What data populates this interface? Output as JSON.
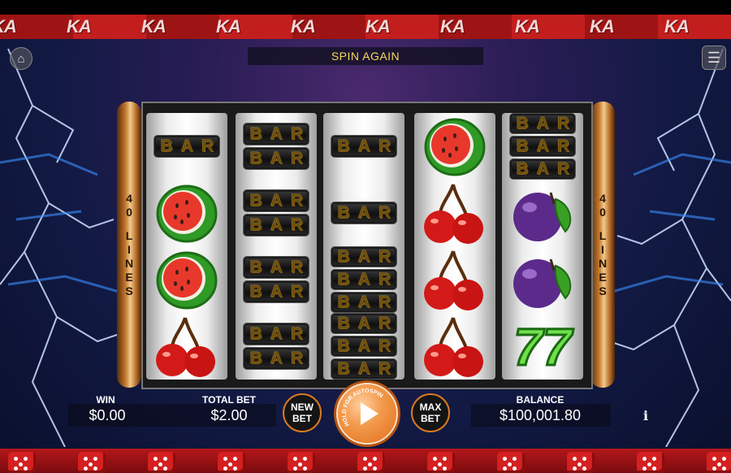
{
  "banner": {
    "message": "SPIN AGAIN"
  },
  "brand_strip": {
    "glyph": "KA"
  },
  "paylines": {
    "left": [
      "4",
      "0",
      "L",
      "I",
      "N",
      "E",
      "S"
    ],
    "right": [
      "4",
      "0",
      "L",
      "I",
      "N",
      "E",
      "S"
    ]
  },
  "reels": [
    [
      "bar",
      "watermelon",
      "watermelon",
      "cherry"
    ],
    [
      "double-bar",
      "double-bar",
      "double-bar",
      "double-bar"
    ],
    [
      "bar",
      "bar",
      "triple-bar",
      "triple-bar"
    ],
    [
      "watermelon",
      "cherry",
      "cherry",
      "cherry"
    ],
    [
      "triple-bar",
      "plum",
      "plum",
      "seven"
    ]
  ],
  "bar_text": "BAR",
  "seven_text": "7",
  "hud": {
    "win_label": "WIN",
    "win_value": "$0.00",
    "total_bet_label": "TOTAL BET",
    "total_bet_value": "$2.00",
    "new_bet_line1": "NEW",
    "new_bet_line2": "BET",
    "max_bet_line1": "MAX",
    "max_bet_line2": "BET",
    "spin_ring_text": "HOLD FOR AUTOSPIN",
    "balance_label": "BALANCE",
    "balance_value": "$100,001.80",
    "info_label": "i"
  },
  "icons": {
    "home": "home-icon",
    "menu": "menu-icon",
    "spin": "play-icon",
    "info": "info-icon"
  },
  "colors": {
    "accent_orange": "#e06f1c",
    "banner_text": "#f7d85a",
    "strip_red": "#c21e1e"
  }
}
